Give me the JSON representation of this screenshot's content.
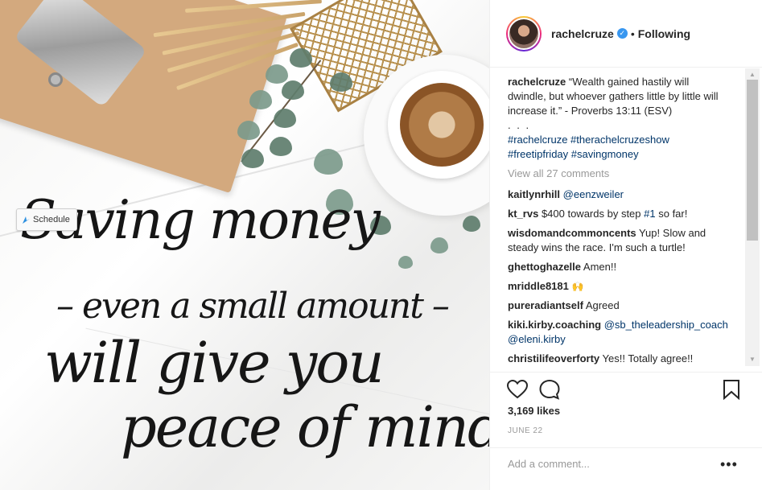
{
  "post": {
    "username": "rachelcruze",
    "following_label": "Following",
    "caption_user": "rachelcruze",
    "caption_text": "“Wealth gained hastily will dwindle, but whoever gathers little by little will increase it.” - Proverbs 13:11 (ESV)",
    "caption_more": ". . .",
    "hashtags_line1": "#rachelcruze #therachelcruzeshow",
    "hashtags_line2": "#freetipfriday #savingmoney",
    "view_all": "View all 27 comments",
    "likes": "3,169 likes",
    "date": "JUNE 22",
    "add_comment_placeholder": "Add a comment...",
    "more_label": "•••"
  },
  "comments": [
    {
      "user": "kaitlynrhill",
      "text": "",
      "mention": "@eenzweiler"
    },
    {
      "user": "kt_rvs",
      "text": "$400 towards by step ",
      "mention": "#1",
      "after": " so far!"
    },
    {
      "user": "wisdomandcommoncents",
      "text": "Yup! Slow and steady wins the race. I'm such a turtle!"
    },
    {
      "user": "ghettoghazelle",
      "text": "Amen!!"
    },
    {
      "user": "mriddle8181",
      "text": "🙌"
    },
    {
      "user": "pureradiantself",
      "text": "Agreed"
    },
    {
      "user": "kiki.kirby.coaching",
      "mention": "@sb_theleadership_coach @eleni.kirby"
    },
    {
      "user": "christilifeoverforty",
      "text": "Yes!! Totally agree!!"
    }
  ],
  "photo": {
    "quote_line1": "Saving money",
    "quote_line2": "– even a small amount –",
    "quote_line3": "will give you",
    "quote_line4": "peace of mind.",
    "schedule_label": "Schedule"
  },
  "colors": {
    "link": "#003569",
    "verified": "#3897f0",
    "muted": "#999999"
  },
  "icons": [
    "heart-icon",
    "comment-icon",
    "bookmark-icon",
    "verified-icon",
    "more-icon"
  ]
}
